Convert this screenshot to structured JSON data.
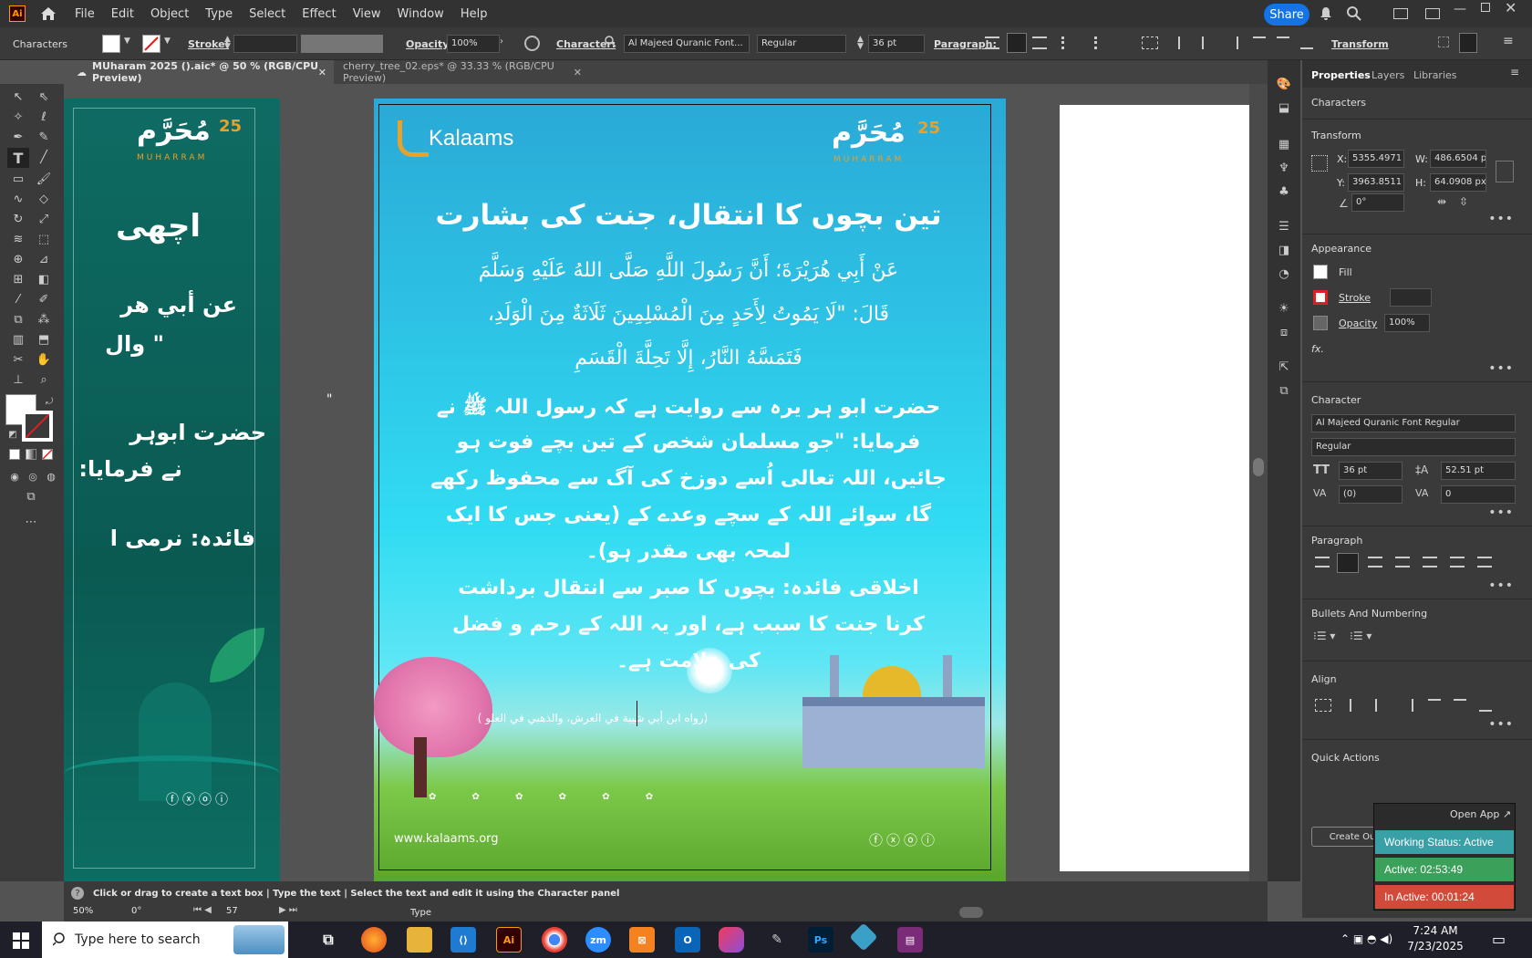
{
  "app": {
    "logo": "Ai"
  },
  "menu": [
    "File",
    "Edit",
    "Object",
    "Type",
    "Select",
    "Effect",
    "View",
    "Window",
    "Help"
  ],
  "share_label": "Share",
  "control": {
    "characters": "Characters",
    "stroke": "Stroke:",
    "opacity_label": "Opacity:",
    "opacity_value": "100%",
    "character_label": "Character:",
    "font": "Al Majeed Quranic Font...",
    "style": "Regular",
    "size": "36 pt",
    "paragraph_label": "Paragraph:",
    "transform": "Transform"
  },
  "tabs": [
    {
      "label": "MUharam 2025 ().aic* @ 50 % (RGB/CPU Preview)"
    },
    {
      "label": "cherry_tree_02.eps* @ 33.33 % (RGB/CPU Preview)"
    }
  ],
  "art_left": {
    "logo_text": "مُحَرَّم",
    "logo_num": "25",
    "logo_sub": "MUHARRAM",
    "line1": "اچھی",
    "line2": "عن أبي هر",
    "line3": "\" وال",
    "line4": "حضرت ابوہر",
    "line5": "نے فرمایا:",
    "line6": "فائدہ: نرمی ا"
  },
  "art_main": {
    "brand": "Kalaams",
    "logo_text": "مُحَرَّم",
    "logo_num": "25",
    "logo_sub": "MUHARRAM",
    "title": "تین بچوں کا انتقال، جنت کی بشارت",
    "arabic": [
      "عَنْ أَبِي هُرَيْرَةَ؛ أَنَّ رَسُولَ اللَّهِ صَلَّى اللهُ عَلَيْهِ وَسَلَّمَ",
      "قَالَ: \"لَا يَمُوتُ لِأَحَدٍ مِنَ الْمُسْلِمِينَ ثَلَاثَةٌ مِنَ الْوَلَدِ،",
      "فَتَمَسَّهُ النَّارُ، إِلَّا تَحِلَّةَ الْقَسَمِ"
    ],
    "urdu": [
      "حضرت ابو ہر یرہ سے روایت ہے کہ رسول اللہ ﷺ نے",
      "فرمایا: \"جو مسلمان شخص کے تین بچے فوت ہو",
      "جائیں، اللہ تعالی اُسے دوزخ کی آگ سے محفوظ رکھے",
      "گا، سوائے اللہ کے سچے وعدے کے (یعنی جس کا ایک",
      "لمحہ بھی مقدر ہو)۔",
      "اخلاقی فائدہ: بچوں کا صبر سے انتقال برداشت",
      "کرنا جنت کا سبب ہے، اور یہ اللہ کے رحم و فضل",
      "کی علامت ہے۔"
    ],
    "reference": "(رواه ابن أبي شيبة في العرش، والذهبي في العلو )",
    "website": "www.kalaams.org",
    "quote_mark": "\""
  },
  "right_panel": {
    "tabs": [
      "Properties",
      "Layers",
      "Libraries"
    ],
    "section_characters": "Characters",
    "transform": "Transform",
    "x_label": "X:",
    "x": "5355.4971",
    "y_label": "Y:",
    "y": "3963.8511",
    "w_label": "W:",
    "w": "486.6504 p",
    "h_label": "H:",
    "h": "64.0908 px",
    "angle": "0°",
    "appearance": "Appearance",
    "fill": "Fill",
    "stroke": "Stroke",
    "opacity": "Opacity",
    "opacity_value": "100%",
    "fx": "fx.",
    "character": "Character",
    "font": "Al Majeed Quranic Font Regular",
    "style": "Regular",
    "size": "36 pt",
    "leading": "52.51 pt",
    "kerning": "(0)",
    "tracking": "0",
    "paragraph": "Paragraph",
    "bullets": "Bullets And Numbering",
    "align": "Align",
    "quick_actions": "Quick Actions",
    "create_outlines": "Create Ou",
    "open_app": "Open App"
  },
  "working_status": {
    "title": "Working Status: Active",
    "active": "Active: 02:53:49",
    "inactive": "In Active: 00:01:24"
  },
  "hint": "Click or drag to create a text box  |  Type the text  |  Select the text and edit it using the Character panel",
  "status": {
    "zoom": "50%",
    "angle": "0°",
    "page": "57",
    "tool": "Type"
  },
  "taskbar": {
    "search": "Type here to search",
    "time": "7:24 AM",
    "date": "7/23/2025"
  },
  "colors": {
    "accent": "#1473e6",
    "active_green": "#3aa05a",
    "inactive_red": "#d24b3a",
    "status_teal": "#3aa0a8"
  }
}
